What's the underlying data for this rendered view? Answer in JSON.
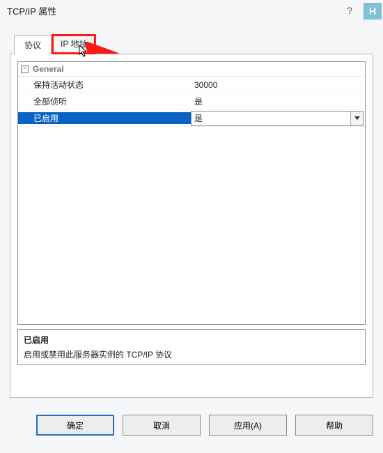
{
  "window": {
    "title": "TCP/IP 属性",
    "help": "?",
    "close_icon": "×",
    "watermark": "H"
  },
  "tabs": {
    "items": [
      {
        "label": "协议"
      },
      {
        "label": "IP 地址"
      }
    ]
  },
  "properties": {
    "group_label": "General",
    "expander": "−",
    "rows": [
      {
        "key": "保持活动状态",
        "value": "30000"
      },
      {
        "key": "全部侦听",
        "value": "是"
      },
      {
        "key": "已启用",
        "value": "是"
      }
    ]
  },
  "description": {
    "title": "已启用",
    "text": "启用或禁用此服务器实例的 TCP/IP 协议"
  },
  "buttons": {
    "ok": "确定",
    "cancel": "取消",
    "apply": "应用(A)",
    "help": "帮助"
  }
}
